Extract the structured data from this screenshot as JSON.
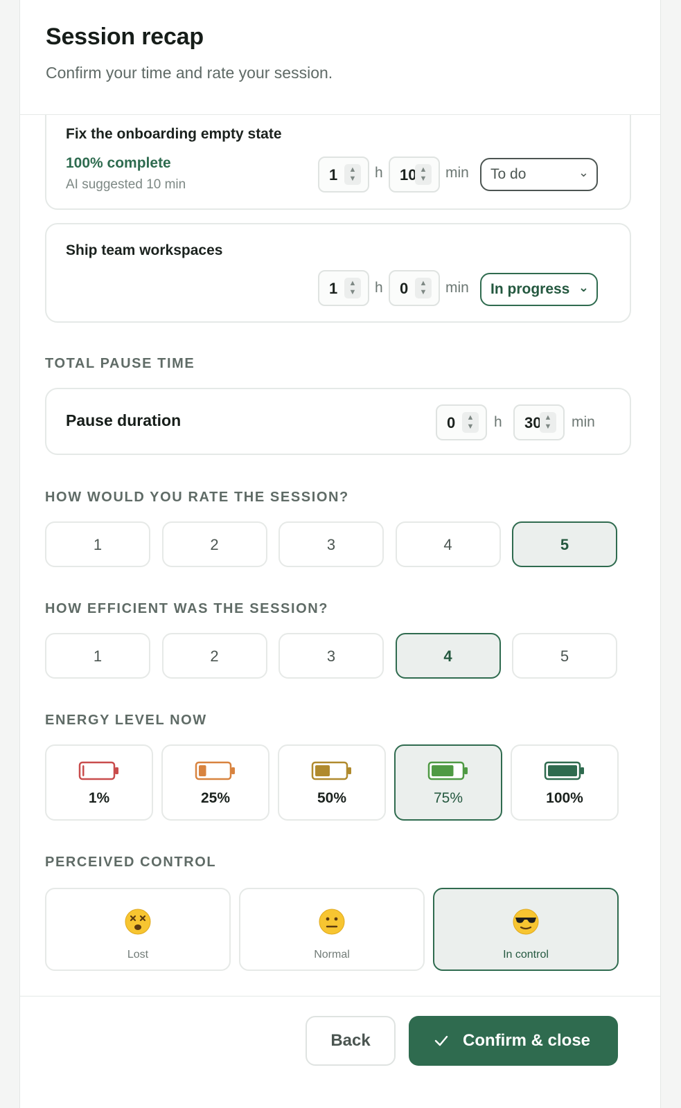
{
  "header": {
    "title": "Session recap",
    "subtitle": "Confirm your time and rate your session."
  },
  "tasks": [
    {
      "title": "Fix the onboarding empty state",
      "progress": "100% complete",
      "ai_hint": "AI suggested 10 min",
      "hours": "1",
      "minutes": "10",
      "hours_unit": "h",
      "minutes_unit": "min",
      "status": "To do"
    },
    {
      "title": "Ship team workspaces",
      "hours": "1",
      "minutes": "0",
      "hours_unit": "h",
      "minutes_unit": "min",
      "status": "In progress"
    }
  ],
  "pause": {
    "section_label": "TOTAL PAUSE TIME",
    "label": "Pause duration",
    "hours": "0",
    "minutes": "30",
    "hours_unit": "h",
    "minutes_unit": "min"
  },
  "rating": {
    "section_label": "HOW WOULD YOU RATE THE SESSION?",
    "options": [
      "1",
      "2",
      "3",
      "4",
      "5"
    ],
    "selected": "5"
  },
  "efficiency": {
    "section_label": "HOW EFFICIENT WAS THE SESSION?",
    "options": [
      "1",
      "2",
      "3",
      "4",
      "5"
    ],
    "selected": "4"
  },
  "energy": {
    "section_label": "ENERGY LEVEL NOW",
    "options": [
      {
        "label": "1%",
        "level": 0.01,
        "color": "#c94c4c"
      },
      {
        "label": "25%",
        "level": 0.25,
        "color": "#d8833f"
      },
      {
        "label": "50%",
        "level": 0.5,
        "color": "#b08a2e"
      },
      {
        "label": "75%",
        "level": 0.75,
        "color": "#4f9a44"
      },
      {
        "label": "100%",
        "level": 1.0,
        "color": "#2f6b4f"
      }
    ],
    "selected": "75%"
  },
  "control": {
    "section_label": "PERCEIVED CONTROL",
    "options": [
      {
        "label": "Lost",
        "icon": "dizzy-face-icon"
      },
      {
        "label": "Normal",
        "icon": "neutral-face-icon"
      },
      {
        "label": "In control",
        "icon": "sunglasses-face-icon"
      }
    ],
    "selected": "In control"
  },
  "footer": {
    "back_label": "Back",
    "confirm_label": "Confirm & close"
  },
  "colors": {
    "accent": "#2f6b4f",
    "selected_bg": "#ebefed"
  }
}
